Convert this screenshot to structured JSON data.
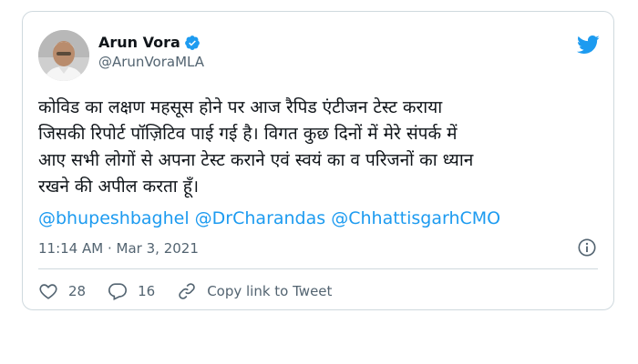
{
  "tweet": {
    "author": {
      "display_name": "Arun Vora",
      "handle": "@ArunVoraMLA",
      "verified_icon": "verified-badge-icon",
      "avatar_icon": "avatar"
    },
    "brand_icon": "twitter-bird-icon",
    "text_lines": [
      "कोविड का लक्षण महसूस होने पर आज रैपिड एंटीजन टेस्ट कराया",
      "जिसकी रिपोर्ट पॉज़िटिव पाई गई है। विगत कुछ दिनों में मेरे संपर्क में",
      "आए सभी लोगों से अपना टेस्ट कराने एवं स्वयं का व परिजनों का ध्यान",
      "रखने की अपील करता हूँ।"
    ],
    "mentions": [
      "@bhupeshbaghel",
      "@DrCharandas",
      "@ChhattisgarhCMO"
    ],
    "time": "11:14 AM",
    "separator": "·",
    "date": "Mar 3, 2021",
    "info_icon": "info-icon",
    "actions": {
      "like_count": "28",
      "reply_count": "16",
      "copy_link_label": "Copy link to Tweet"
    }
  },
  "colors": {
    "link": "#1d9bf0",
    "text": "#0f1419",
    "secondary": "#536471",
    "border": "#cfd9de"
  }
}
